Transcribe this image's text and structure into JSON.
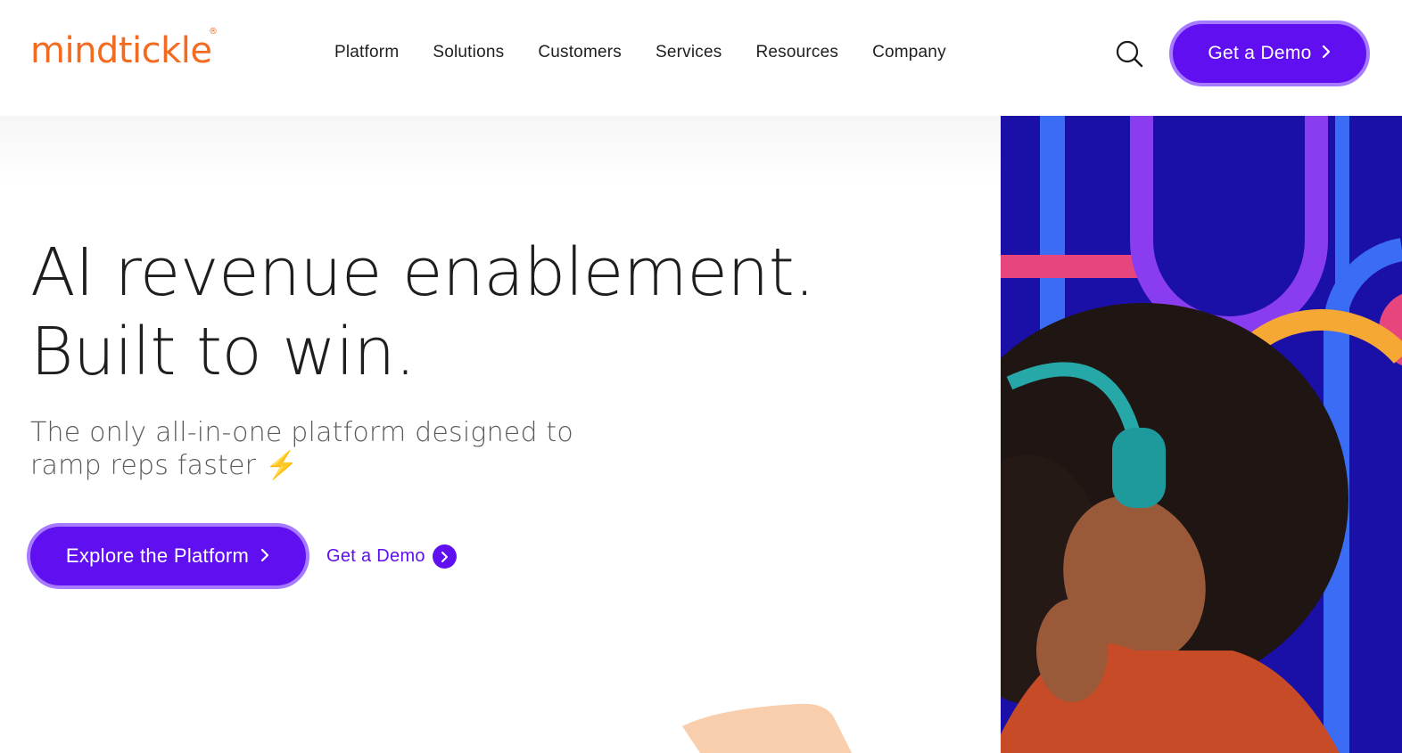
{
  "header": {
    "logo_text": "mindtickle",
    "logo_mark": "®",
    "nav": [
      "Platform",
      "Solutions",
      "Customers",
      "Services",
      "Resources",
      "Company"
    ],
    "search_icon": "search-icon",
    "cta_label": "Get a Demo"
  },
  "hero": {
    "headline_line1": "AI revenue enablement.",
    "headline_line2": "Built to win.",
    "subhead_text": "The only all-in-one platform designed to ramp reps faster",
    "subhead_emoji": "⚡",
    "primary_cta": "Explore the Platform",
    "secondary_cta": "Get a Demo"
  },
  "colors": {
    "brand_orange": "#f26b21",
    "accent_purple": "#5f0ff0",
    "accent_border": "#a77bff",
    "art_navy": "#1a10a8"
  }
}
